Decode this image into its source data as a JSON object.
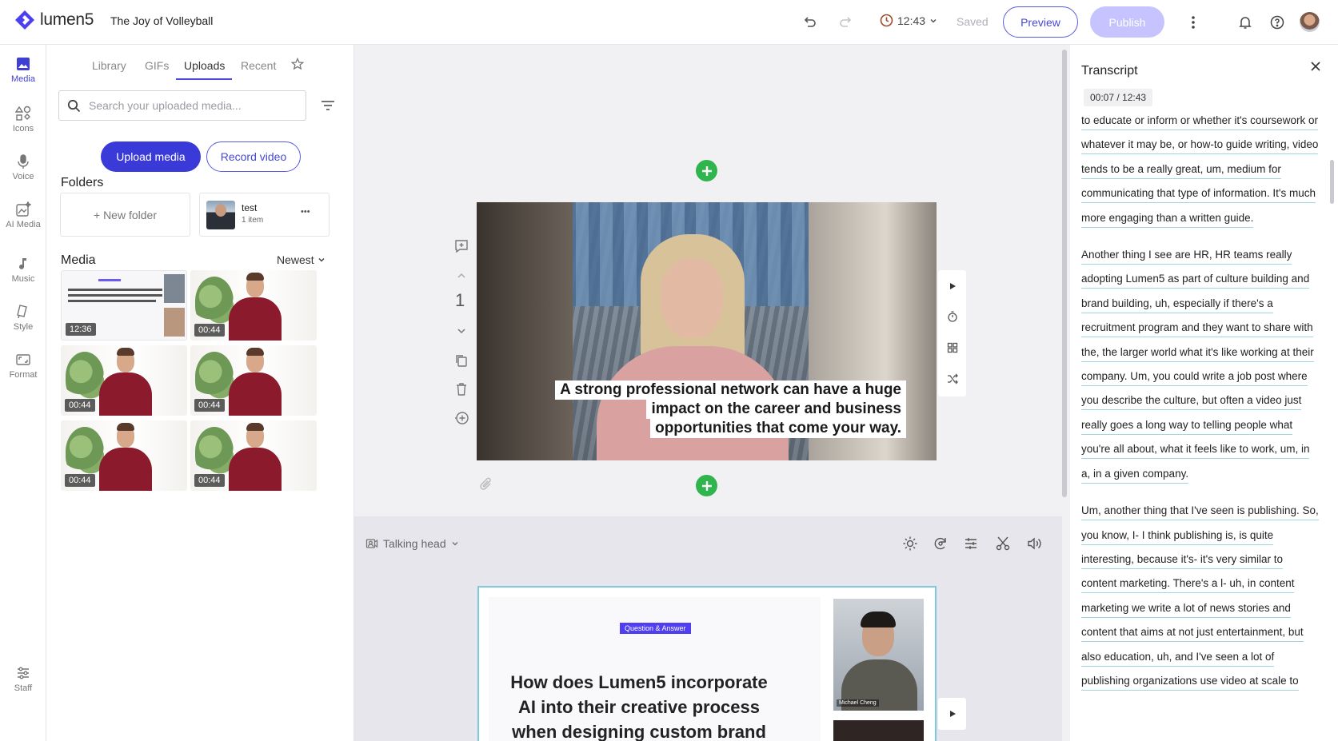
{
  "app": {
    "brand": "lumen5",
    "project_title": "The Joy of Volleyball",
    "timer": "12:43",
    "saved": "Saved",
    "preview": "Preview",
    "publish": "Publish",
    "accent": "#3a3ad8",
    "publish_color": "#c6c3ff"
  },
  "rail": [
    {
      "label": "Media",
      "icon": "image-icon"
    },
    {
      "label": "Icons",
      "icon": "shapes-icon"
    },
    {
      "label": "Voice",
      "icon": "microphone-icon"
    },
    {
      "label": "AI Media",
      "icon": "ai-image-icon"
    },
    {
      "label": "Music",
      "icon": "music-note-icon"
    },
    {
      "label": "Style",
      "icon": "paint-brush-icon"
    },
    {
      "label": "Format",
      "icon": "aspect-ratio-icon"
    },
    {
      "label": "Staff",
      "icon": "sliders-icon"
    }
  ],
  "media_panel": {
    "tabs": [
      "Library",
      "GIFs",
      "Uploads",
      "Recent"
    ],
    "active_tab": "Uploads",
    "search_placeholder": "Search your uploaded media...",
    "upload_button": "Upload media",
    "record_button": "Record video",
    "folders_title": "Folders",
    "new_folder": "+ New folder",
    "folder": {
      "name": "test",
      "count": "1 item",
      "more": "•••"
    },
    "media_title": "Media",
    "sort": "Newest",
    "thumbs": [
      {
        "duration": "12:36",
        "kind": "slide"
      },
      {
        "duration": "00:44",
        "kind": "person"
      },
      {
        "duration": "00:44",
        "kind": "person"
      },
      {
        "duration": "00:44",
        "kind": "person"
      },
      {
        "duration": "00:44",
        "kind": "person"
      },
      {
        "duration": "00:44",
        "kind": "person"
      }
    ]
  },
  "scene": {
    "number": "1",
    "caption_lines": [
      "A strong professional network can have a huge",
      "impact on the career and business",
      "opportunities that come your way."
    ]
  },
  "talking_head": {
    "label": "Talking head",
    "badge": "Question & Answer",
    "heading": "How does Lumen5 incorporate AI into their creative process when designing custom brand",
    "photo_caption": "Michael Cheng"
  },
  "transcript": {
    "title": "Transcript",
    "time": "00:07 / 12:43",
    "paragraphs": [
      "to educate or inform or whether it's coursework or whatever it may be, or how-to guide writing, video tends to be a really great, um, medium for communicating that type of information. It's much more engaging than a written guide.",
      "Another thing I see are HR, HR teams really adopting Lumen5 as part of culture building and brand building, uh, especially if there's a recruitment program and they want to share with the, the larger world what it's like working at their company. Um, you could write a job post where you describe the culture, but often a video just really goes a long way to telling people what you're all about, what it feels like to work, um, in a, in a given company.",
      "Um, another thing that I've seen is publishing. So, you know, I- I think publishing is, is quite interesting, because it's- it's very similar to content marketing. There's a l- uh, in content marketing we write a lot of news stories and content that aims at not just entertainment, but also education, uh, and I've seen a lot of publishing organizations use video at scale to"
    ]
  }
}
